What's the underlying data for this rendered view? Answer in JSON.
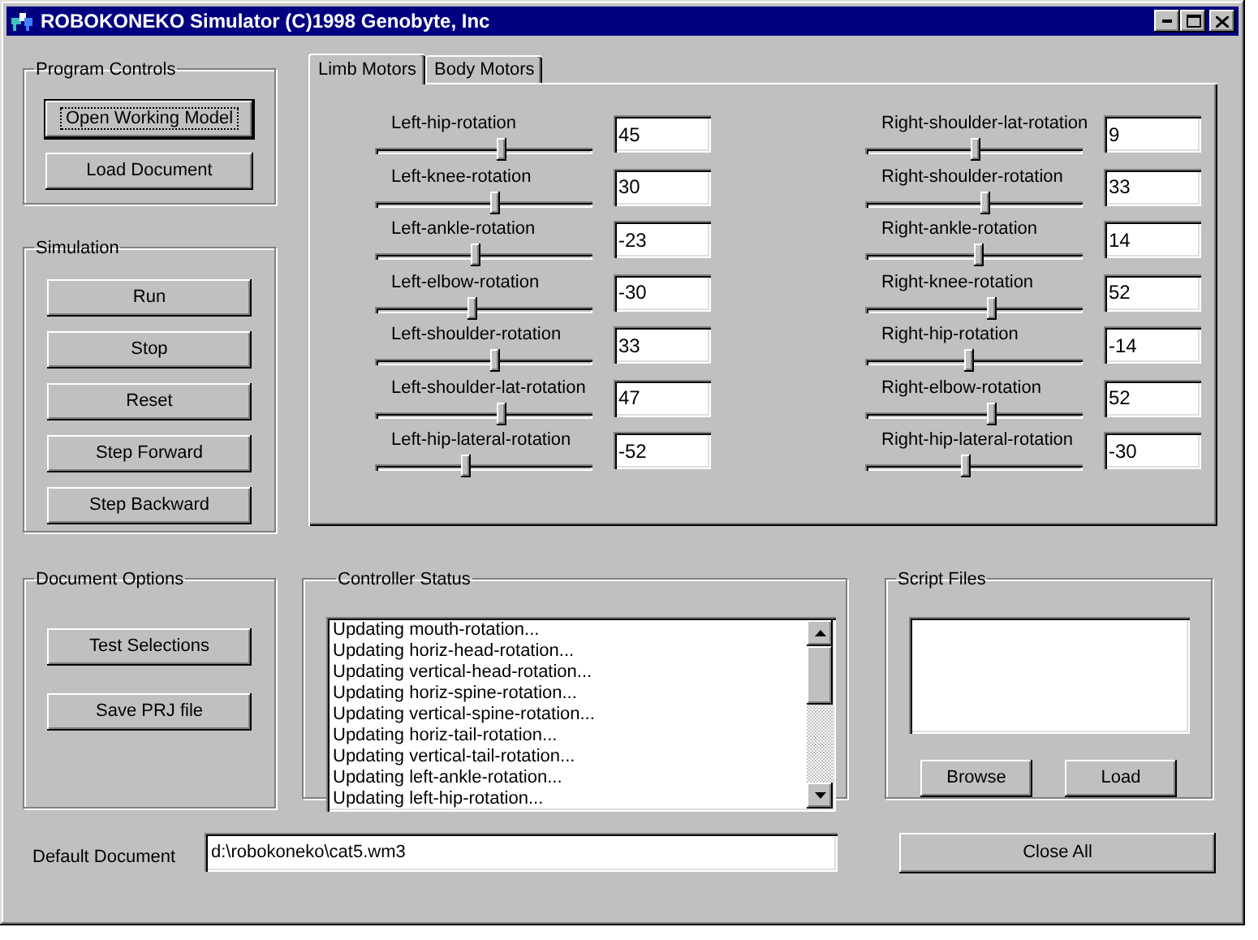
{
  "window": {
    "title": "ROBOKONEKO Simulator (C)1998 Genobyte, Inc"
  },
  "program_controls": {
    "title": "Program Controls",
    "buttons": [
      {
        "label": "Open Working Model",
        "default": true
      },
      {
        "label": "Load Document",
        "default": false
      }
    ]
  },
  "simulation": {
    "title": "Simulation",
    "buttons": [
      "Run",
      "Stop",
      "Reset",
      "Step Forward",
      "Step Backward"
    ]
  },
  "tabs": [
    {
      "label": "Limb Motors",
      "selected": true
    },
    {
      "label": "Body Motors",
      "selected": false
    }
  ],
  "motors_left": [
    {
      "name": "Left-hip-rotation",
      "level": 0.58,
      "value": "45"
    },
    {
      "name": "Left-knee-rotation",
      "level": 0.55,
      "value": "30"
    },
    {
      "name": "Left-ankle-rotation",
      "level": 0.46,
      "value": "-23"
    },
    {
      "name": "Left-elbow-rotation",
      "level": 0.45,
      "value": "-30"
    },
    {
      "name": "Left-shoulder-rotation",
      "level": 0.55,
      "value": "33"
    },
    {
      "name": "Left-shoulder-lat-rotation",
      "level": 0.58,
      "value": "47"
    },
    {
      "name": "Left-hip-lateral-rotation",
      "level": 0.42,
      "value": "-52"
    }
  ],
  "motors_right": [
    {
      "name": "Right-shoulder-lat-rotation",
      "level": 0.51,
      "value": "9"
    },
    {
      "name": "Right-shoulder-rotation",
      "level": 0.55,
      "value": "33"
    },
    {
      "name": "Right-ankle-rotation",
      "level": 0.52,
      "value": "14"
    },
    {
      "name": "Right-knee-rotation",
      "level": 0.58,
      "value": "52"
    },
    {
      "name": "Right-hip-rotation",
      "level": 0.48,
      "value": "-14"
    },
    {
      "name": "Right-elbow-rotation",
      "level": 0.58,
      "value": "52"
    },
    {
      "name": "Right-hip-lateral-rotation",
      "level": 0.46,
      "value": "-30"
    }
  ],
  "document_options": {
    "title": "Document Options",
    "buttons": [
      "Test Selections",
      "Save PRJ file"
    ]
  },
  "controller_status": {
    "title": "Controller Status",
    "lines": [
      "Updating mouth-rotation...",
      "Updating horiz-head-rotation...",
      "Updating vertical-head-rotation...",
      "Updating horiz-spine-rotation...",
      "Updating vertical-spine-rotation...",
      "Updating horiz-tail-rotation...",
      "Updating vertical-tail-rotation...",
      "Updating left-ankle-rotation...",
      "Updating left-hip-rotation..."
    ]
  },
  "script_files": {
    "title": "Script Files",
    "buttons": [
      "Browse",
      "Load"
    ]
  },
  "default_document": {
    "label": "Default Document",
    "value": "d:\\robokoneko\\cat5.wm3"
  },
  "close_button": "Close All"
}
